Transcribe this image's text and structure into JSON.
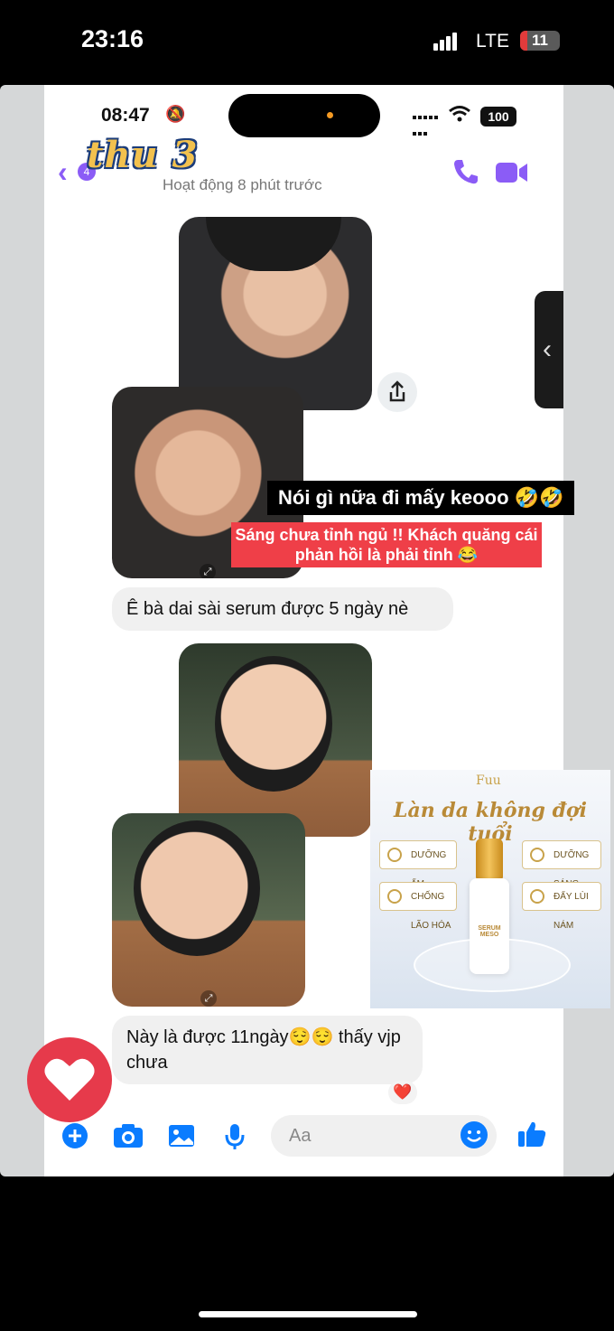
{
  "outer_status": {
    "time": "23:16",
    "network": "LTE",
    "battery": "11"
  },
  "inner_status": {
    "time": "08:47",
    "battery": "100"
  },
  "chat_header": {
    "back_badge": "4",
    "name_sticker": "thu 3",
    "activity": "Hoạt động 8 phút trước"
  },
  "overlay": {
    "caption_black": "Nói gì nữa đi mấy keooo 🤣🤣",
    "caption_red": "Sáng chưa tỉnh ngủ !! Khách quăng cái phản hồi là phải tỉnh 😂"
  },
  "messages": [
    {
      "text": "Ê bà dai sài serum được 5 ngày nè"
    },
    {
      "text": "Này là được 11ngày😌😌 thấy vjp chưa",
      "reaction": "❤️"
    }
  ],
  "promo": {
    "logo": "Fuu",
    "title": "Làn da không đợi tuổi",
    "chips": [
      "DƯỠNG ẨM",
      "DƯỠNG SÁNG",
      "CHỐNG LÃO HÓA",
      "ĐẨY LÙI NÁM"
    ],
    "bottle_label": "SERUM MESO"
  },
  "composer": {
    "placeholder": "Aa"
  },
  "colors": {
    "accent": "#8b5cf6",
    "messenger_blue": "#0a7cff",
    "heart": "#e63a4b"
  }
}
